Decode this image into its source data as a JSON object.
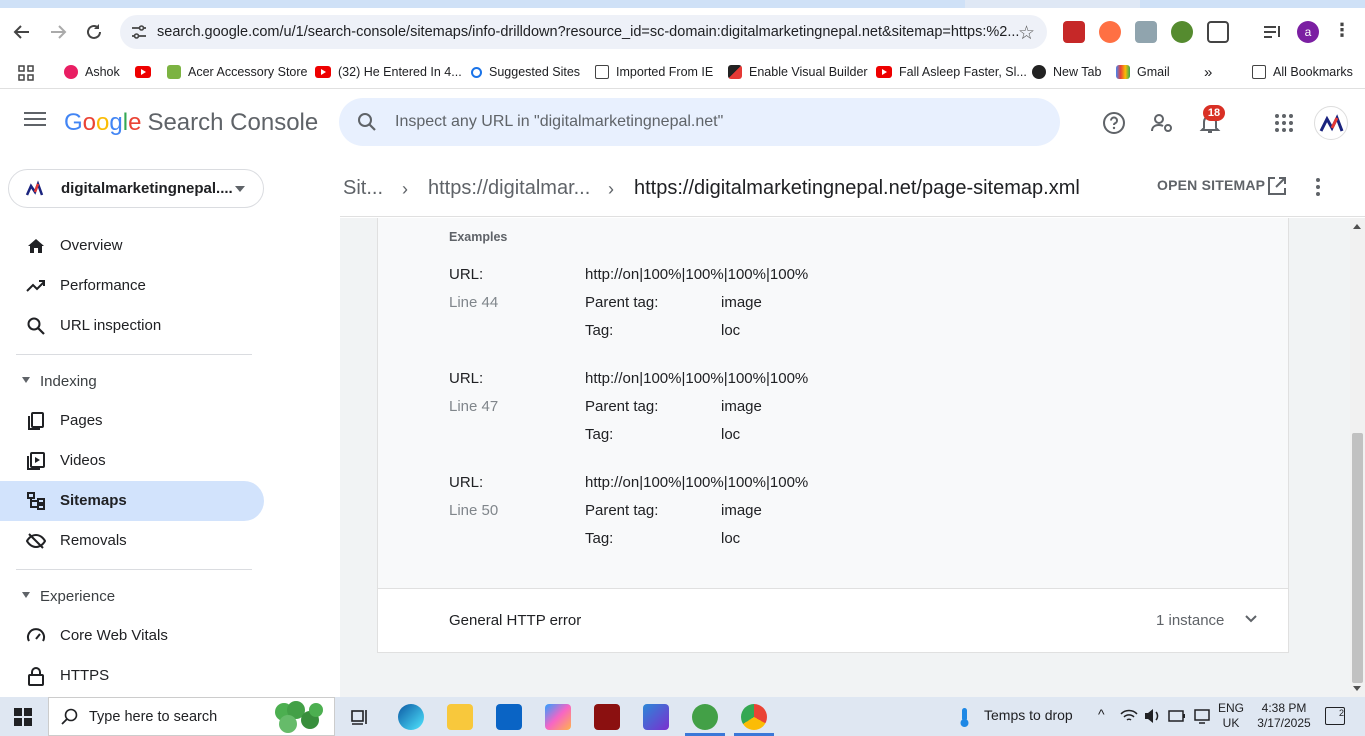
{
  "browser": {
    "url": "search.google.com/u/1/search-console/sitemaps/info-drilldown?resource_id=sc-domain:digitalmarketingnepal.net&sitemap=https:%2...",
    "profile_initial": "a",
    "bookmarks": [
      {
        "label": "Ashok",
        "icon": "firefox-like-icon"
      },
      {
        "label": "",
        "icon": "youtube-icon"
      },
      {
        "label": "Acer Accessory Store",
        "icon": "acer-icon"
      },
      {
        "label": "(32) He Entered In 4...",
        "icon": "youtube-icon"
      },
      {
        "label": "Suggested Sites",
        "icon": "search-icon"
      },
      {
        "label": "Imported From IE",
        "icon": "folder-icon"
      },
      {
        "label": "Enable Visual Builder",
        "icon": "site-logo-icon"
      },
      {
        "label": "Fall Asleep Faster, Sl...",
        "icon": "youtube-icon"
      },
      {
        "label": "New Tab",
        "icon": "globe-icon"
      },
      {
        "label": "Gmail",
        "icon": "gmail-icon"
      }
    ],
    "all_bookmarks_label": "All Bookmarks"
  },
  "header": {
    "logo_google": [
      "G",
      "o",
      "o",
      "g",
      "l",
      "e"
    ],
    "logo_product": "Search Console",
    "search_placeholder": "Inspect any URL in \"digitalmarketingnepal.net\"",
    "notification_count": "18"
  },
  "sidebar": {
    "property": "digitalmarketingnepal....",
    "items": [
      {
        "label": "Overview",
        "icon": "home-icon"
      },
      {
        "label": "Performance",
        "icon": "trending-up-icon"
      },
      {
        "label": "URL inspection",
        "icon": "search-icon"
      }
    ],
    "sections": [
      {
        "label": "Indexing",
        "items": [
          {
            "label": "Pages",
            "icon": "pages-icon"
          },
          {
            "label": "Videos",
            "icon": "video-icon"
          },
          {
            "label": "Sitemaps",
            "icon": "sitemap-icon",
            "active": true
          },
          {
            "label": "Removals",
            "icon": "removal-icon"
          }
        ]
      },
      {
        "label": "Experience",
        "items": [
          {
            "label": "Core Web Vitals",
            "icon": "gauge-icon"
          },
          {
            "label": "HTTPS",
            "icon": "lock-icon"
          }
        ]
      }
    ]
  },
  "breadcrumb": {
    "items": [
      "Sit...",
      "https://digitalmar...",
      "https://digitalmarketingnepal.net/page-sitemap.xml"
    ],
    "open_sitemap": "OPEN SITEMAP"
  },
  "main": {
    "examples_label": "Examples",
    "examples": [
      {
        "url_label": "URL:",
        "url": "http://on|100%|100%|100%|100%",
        "line": "Line 44",
        "parent_tag_label": "Parent tag:",
        "parent_tag": "image",
        "tag_label": "Tag:",
        "tag": "loc"
      },
      {
        "url_label": "URL:",
        "url": "http://on|100%|100%|100%|100%",
        "line": "Line 47",
        "parent_tag_label": "Parent tag:",
        "parent_tag": "image",
        "tag_label": "Tag:",
        "tag": "loc"
      },
      {
        "url_label": "URL:",
        "url": "http://on|100%|100%|100%|100%",
        "line": "Line 50",
        "parent_tag_label": "Parent tag:",
        "parent_tag": "image",
        "tag_label": "Tag:",
        "tag": "loc"
      }
    ],
    "error": {
      "title": "General HTTP error",
      "instances": "1 instance"
    }
  },
  "taskbar": {
    "search_text": "Type here to search",
    "weather": "Temps to drop",
    "lang_line1": "ENG",
    "lang_line2": "UK",
    "time": "4:38 PM",
    "date": "3/17/2025",
    "notifications": "2"
  },
  "colors": {
    "accent": "#1a73e8",
    "active_nav": "#d2e3fc",
    "badge": "#d93025"
  }
}
